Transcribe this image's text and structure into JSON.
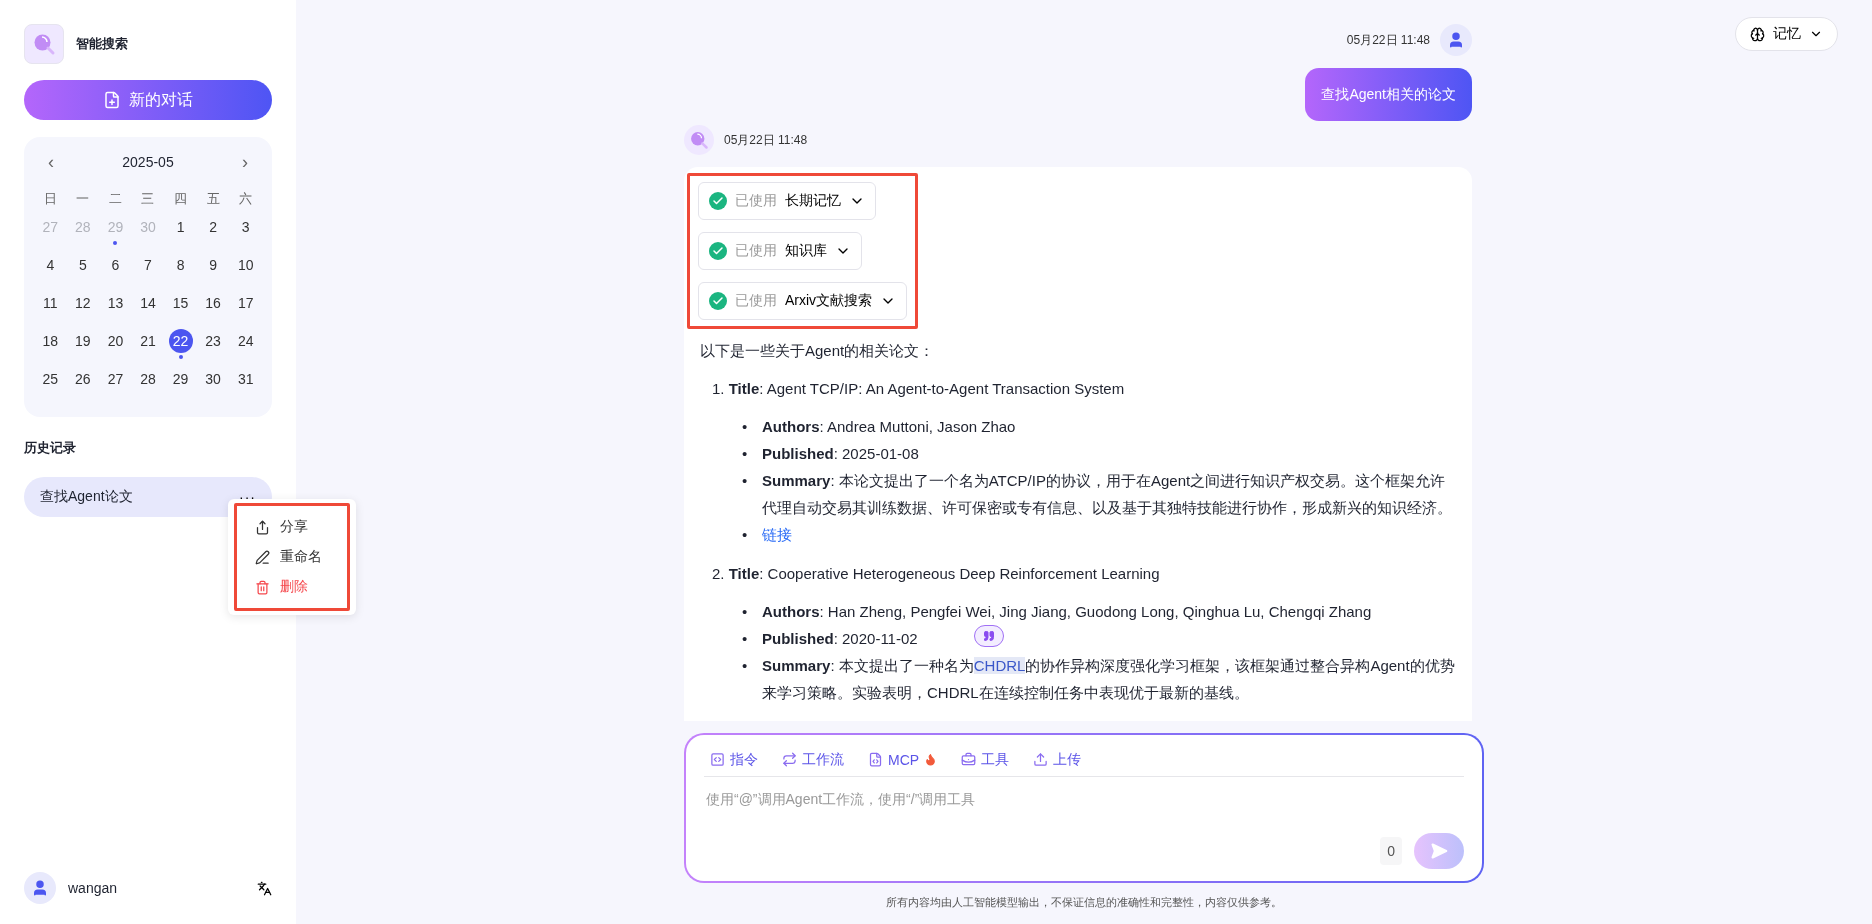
{
  "app": {
    "name": "智能搜索"
  },
  "new_chat": {
    "label": "新的对话"
  },
  "calendar": {
    "month": "2025-05",
    "prev": "‹",
    "next": "›",
    "weekdays": [
      "日",
      "一",
      "二",
      "三",
      "四",
      "五",
      "六"
    ],
    "days": [
      {
        "label": "27",
        "muted": true,
        "selected": false,
        "has_record": false
      },
      {
        "label": "28",
        "muted": true,
        "selected": false,
        "has_record": false
      },
      {
        "label": "29",
        "muted": true,
        "selected": false,
        "has_record": true
      },
      {
        "label": "30",
        "muted": true,
        "selected": false,
        "has_record": false
      },
      {
        "label": "1",
        "muted": false,
        "selected": false,
        "has_record": false
      },
      {
        "label": "2",
        "muted": false,
        "selected": false,
        "has_record": false
      },
      {
        "label": "3",
        "muted": false,
        "selected": false,
        "has_record": false
      },
      {
        "label": "4",
        "muted": false,
        "selected": false,
        "has_record": false
      },
      {
        "label": "5",
        "muted": false,
        "selected": false,
        "has_record": false
      },
      {
        "label": "6",
        "muted": false,
        "selected": false,
        "has_record": false
      },
      {
        "label": "7",
        "muted": false,
        "selected": false,
        "has_record": false
      },
      {
        "label": "8",
        "muted": false,
        "selected": false,
        "has_record": false
      },
      {
        "label": "9",
        "muted": false,
        "selected": false,
        "has_record": false
      },
      {
        "label": "10",
        "muted": false,
        "selected": false,
        "has_record": false
      },
      {
        "label": "11",
        "muted": false,
        "selected": false,
        "has_record": false
      },
      {
        "label": "12",
        "muted": false,
        "selected": false,
        "has_record": false
      },
      {
        "label": "13",
        "muted": false,
        "selected": false,
        "has_record": false
      },
      {
        "label": "14",
        "muted": false,
        "selected": false,
        "has_record": false
      },
      {
        "label": "15",
        "muted": false,
        "selected": false,
        "has_record": false
      },
      {
        "label": "16",
        "muted": false,
        "selected": false,
        "has_record": false
      },
      {
        "label": "17",
        "muted": false,
        "selected": false,
        "has_record": false
      },
      {
        "label": "18",
        "muted": false,
        "selected": false,
        "has_record": false
      },
      {
        "label": "19",
        "muted": false,
        "selected": false,
        "has_record": false
      },
      {
        "label": "20",
        "muted": false,
        "selected": false,
        "has_record": false
      },
      {
        "label": "21",
        "muted": false,
        "selected": false,
        "has_record": false
      },
      {
        "label": "22",
        "muted": false,
        "selected": true,
        "has_record": true
      },
      {
        "label": "23",
        "muted": false,
        "selected": false,
        "has_record": false
      },
      {
        "label": "24",
        "muted": false,
        "selected": false,
        "has_record": false
      },
      {
        "label": "25",
        "muted": false,
        "selected": false,
        "has_record": false
      },
      {
        "label": "26",
        "muted": false,
        "selected": false,
        "has_record": false
      },
      {
        "label": "27",
        "muted": false,
        "selected": false,
        "has_record": false
      },
      {
        "label": "28",
        "muted": false,
        "selected": false,
        "has_record": false
      },
      {
        "label": "29",
        "muted": false,
        "selected": false,
        "has_record": false
      },
      {
        "label": "30",
        "muted": false,
        "selected": false,
        "has_record": false
      },
      {
        "label": "31",
        "muted": false,
        "selected": false,
        "has_record": false
      }
    ]
  },
  "history": {
    "title": "历史记录",
    "items": [
      {
        "label": "查找Agent论文",
        "selected": true,
        "more": "···"
      }
    ],
    "menu": [
      {
        "kind": "share",
        "label": "分享"
      },
      {
        "kind": "rename",
        "label": "重命名"
      },
      {
        "kind": "delete",
        "label": "删除"
      }
    ]
  },
  "user": {
    "name": "wangan"
  },
  "memory_button": {
    "label": "记忆"
  },
  "messages": [
    {
      "kind": "user",
      "time": "05月22日 11:48",
      "text": "查找Agent相关的论文"
    },
    {
      "kind": "assistant",
      "time": "05月22日 11:48",
      "tools": [
        {
          "status": "已使用",
          "name": "长期记忆",
          "done": true
        },
        {
          "status": "已使用",
          "name": "知识库",
          "done": true
        },
        {
          "status": "已使用",
          "name": "Arxiv文献搜索",
          "done": true
        }
      ],
      "intro": "以下是一些关于Agent的相关论文：",
      "papers": [
        {
          "number": "1.",
          "title": "**Title**: Agent TCP/IP: An Agent-to-Agent Transaction System",
          "bullets": [
            {
              "kind": "text",
              "bullet": "•",
              "text": "**Authors**: Andrea Muttoni, Jason Zhao"
            },
            {
              "kind": "text",
              "bullet": "•",
              "text": "**Published**: 2025-01-08"
            },
            {
              "kind": "text",
              "bullet": "•",
              "text": "**Summary**: 本论文提出了一个名为ATCP/IP的协议，用于在Agent之间进行知识产权交易。这个框架允许代理自动交易其训练数据、许可保密或专有信息、以及基于其独特技能进行协作，形成新兴的知识经济。"
            },
            {
              "kind": "link",
              "bullet": "•",
              "text": "链接"
            }
          ]
        },
        {
          "number": "2.",
          "title": "**Title**: Cooperative Heterogeneous Deep Reinforcement Learning",
          "bullets": [
            {
              "kind": "text",
              "bullet": "•",
              "text": "**Authors**: Han Zheng, Pengfei Wei, Jing Jiang, Guodong Long, Qinghua Lu, Chengqi Zhang"
            },
            {
              "kind": "text",
              "bullet": "•",
              "text": "**Published**: 2020-11-02"
            },
            {
              "kind": "selection",
              "bullet": "•",
              "before": "**Summary**: 本文提出了一种名为",
              "selected": "CHDRL",
              "after": "的协作异构深度强化学习框架，该框架通过整合异构Agent的优势来学习策略。实验表明，CHDRL在连续控制任务中表现优于最新的基线。"
            }
          ]
        }
      ]
    }
  ],
  "composer": {
    "tools": [
      {
        "kind": "command",
        "label": "指令"
      },
      {
        "kind": "workflow",
        "label": "工作流"
      },
      {
        "kind": "mcp",
        "label": "MCP",
        "hot": true
      },
      {
        "kind": "tool",
        "label": "工具"
      },
      {
        "kind": "upload",
        "label": "上传"
      }
    ],
    "placeholder": "使用“@”调用Agent工作流，使用“/”调用工具",
    "count": "0"
  },
  "disclaimer": "所有内容均由人工智能模型输出，不保证信息的准确性和完整性，内容仅供参考。"
}
